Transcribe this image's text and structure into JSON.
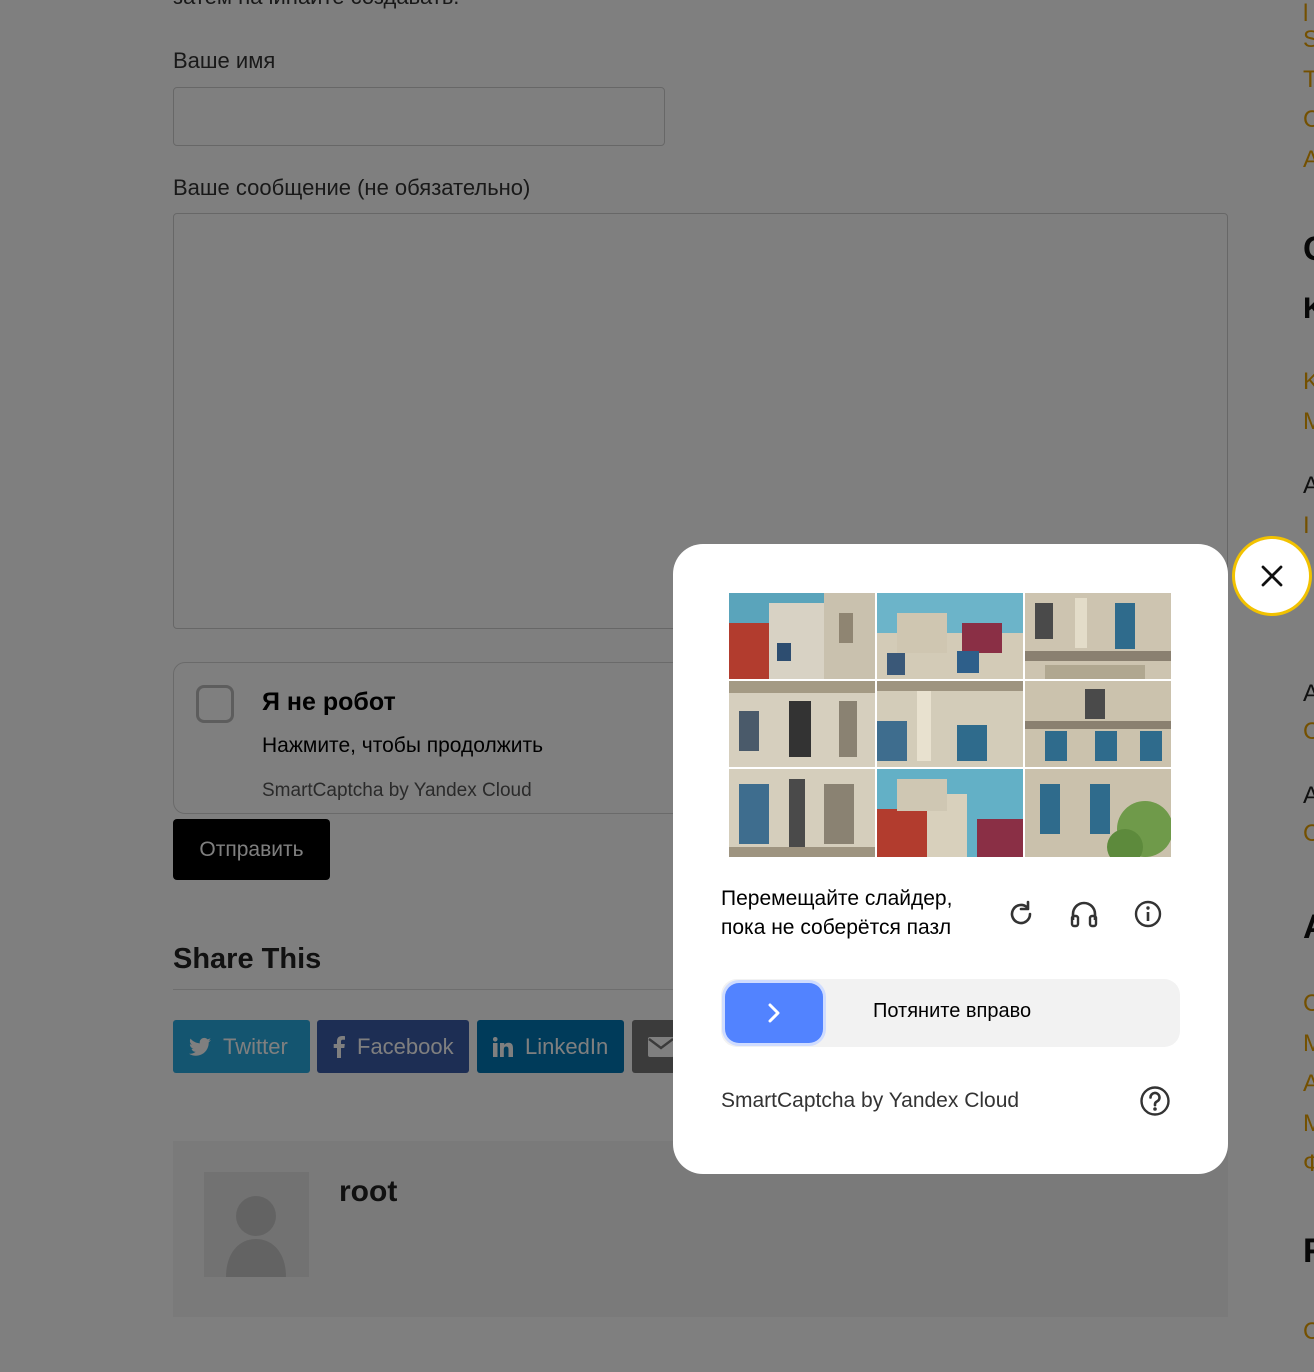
{
  "page": {
    "cut_text": "затем начинайте создавать.",
    "name_label": "Ваше имя",
    "message_label": "Ваше сообщение (не обязательно)",
    "inline_captcha": {
      "title": "Я не робот",
      "subtitle": "Нажмите, чтобы продолжить",
      "brand": "SmartCaptcha by Yandex Cloud"
    },
    "submit_label": "Отправить",
    "share_heading": "Share This",
    "share_buttons": [
      {
        "label": "Twitter",
        "icon": "twitter-icon"
      },
      {
        "label": "Facebook",
        "icon": "facebook-icon"
      },
      {
        "label": "LinkedIn",
        "icon": "linkedin-icon"
      },
      {
        "label": "",
        "icon": "email-icon"
      }
    ],
    "author_name": "root"
  },
  "modal": {
    "instruction": "Перемещайте слайдер, пока не соберётся пазл",
    "icons": [
      "refresh-icon",
      "headphones-icon",
      "info-icon"
    ],
    "slider_text": "Потяните вправо",
    "brand": "SmartCaptcha by Yandex Cloud",
    "help_icon": "help-icon",
    "close_icon": "close-icon"
  },
  "colors": {
    "overlay": "#000000",
    "slider_handle": "#5283ff",
    "close_ring": "#f2c200",
    "twitter": "#29aae1",
    "facebook": "#3b5ca8",
    "linkedin": "#0077b5"
  }
}
